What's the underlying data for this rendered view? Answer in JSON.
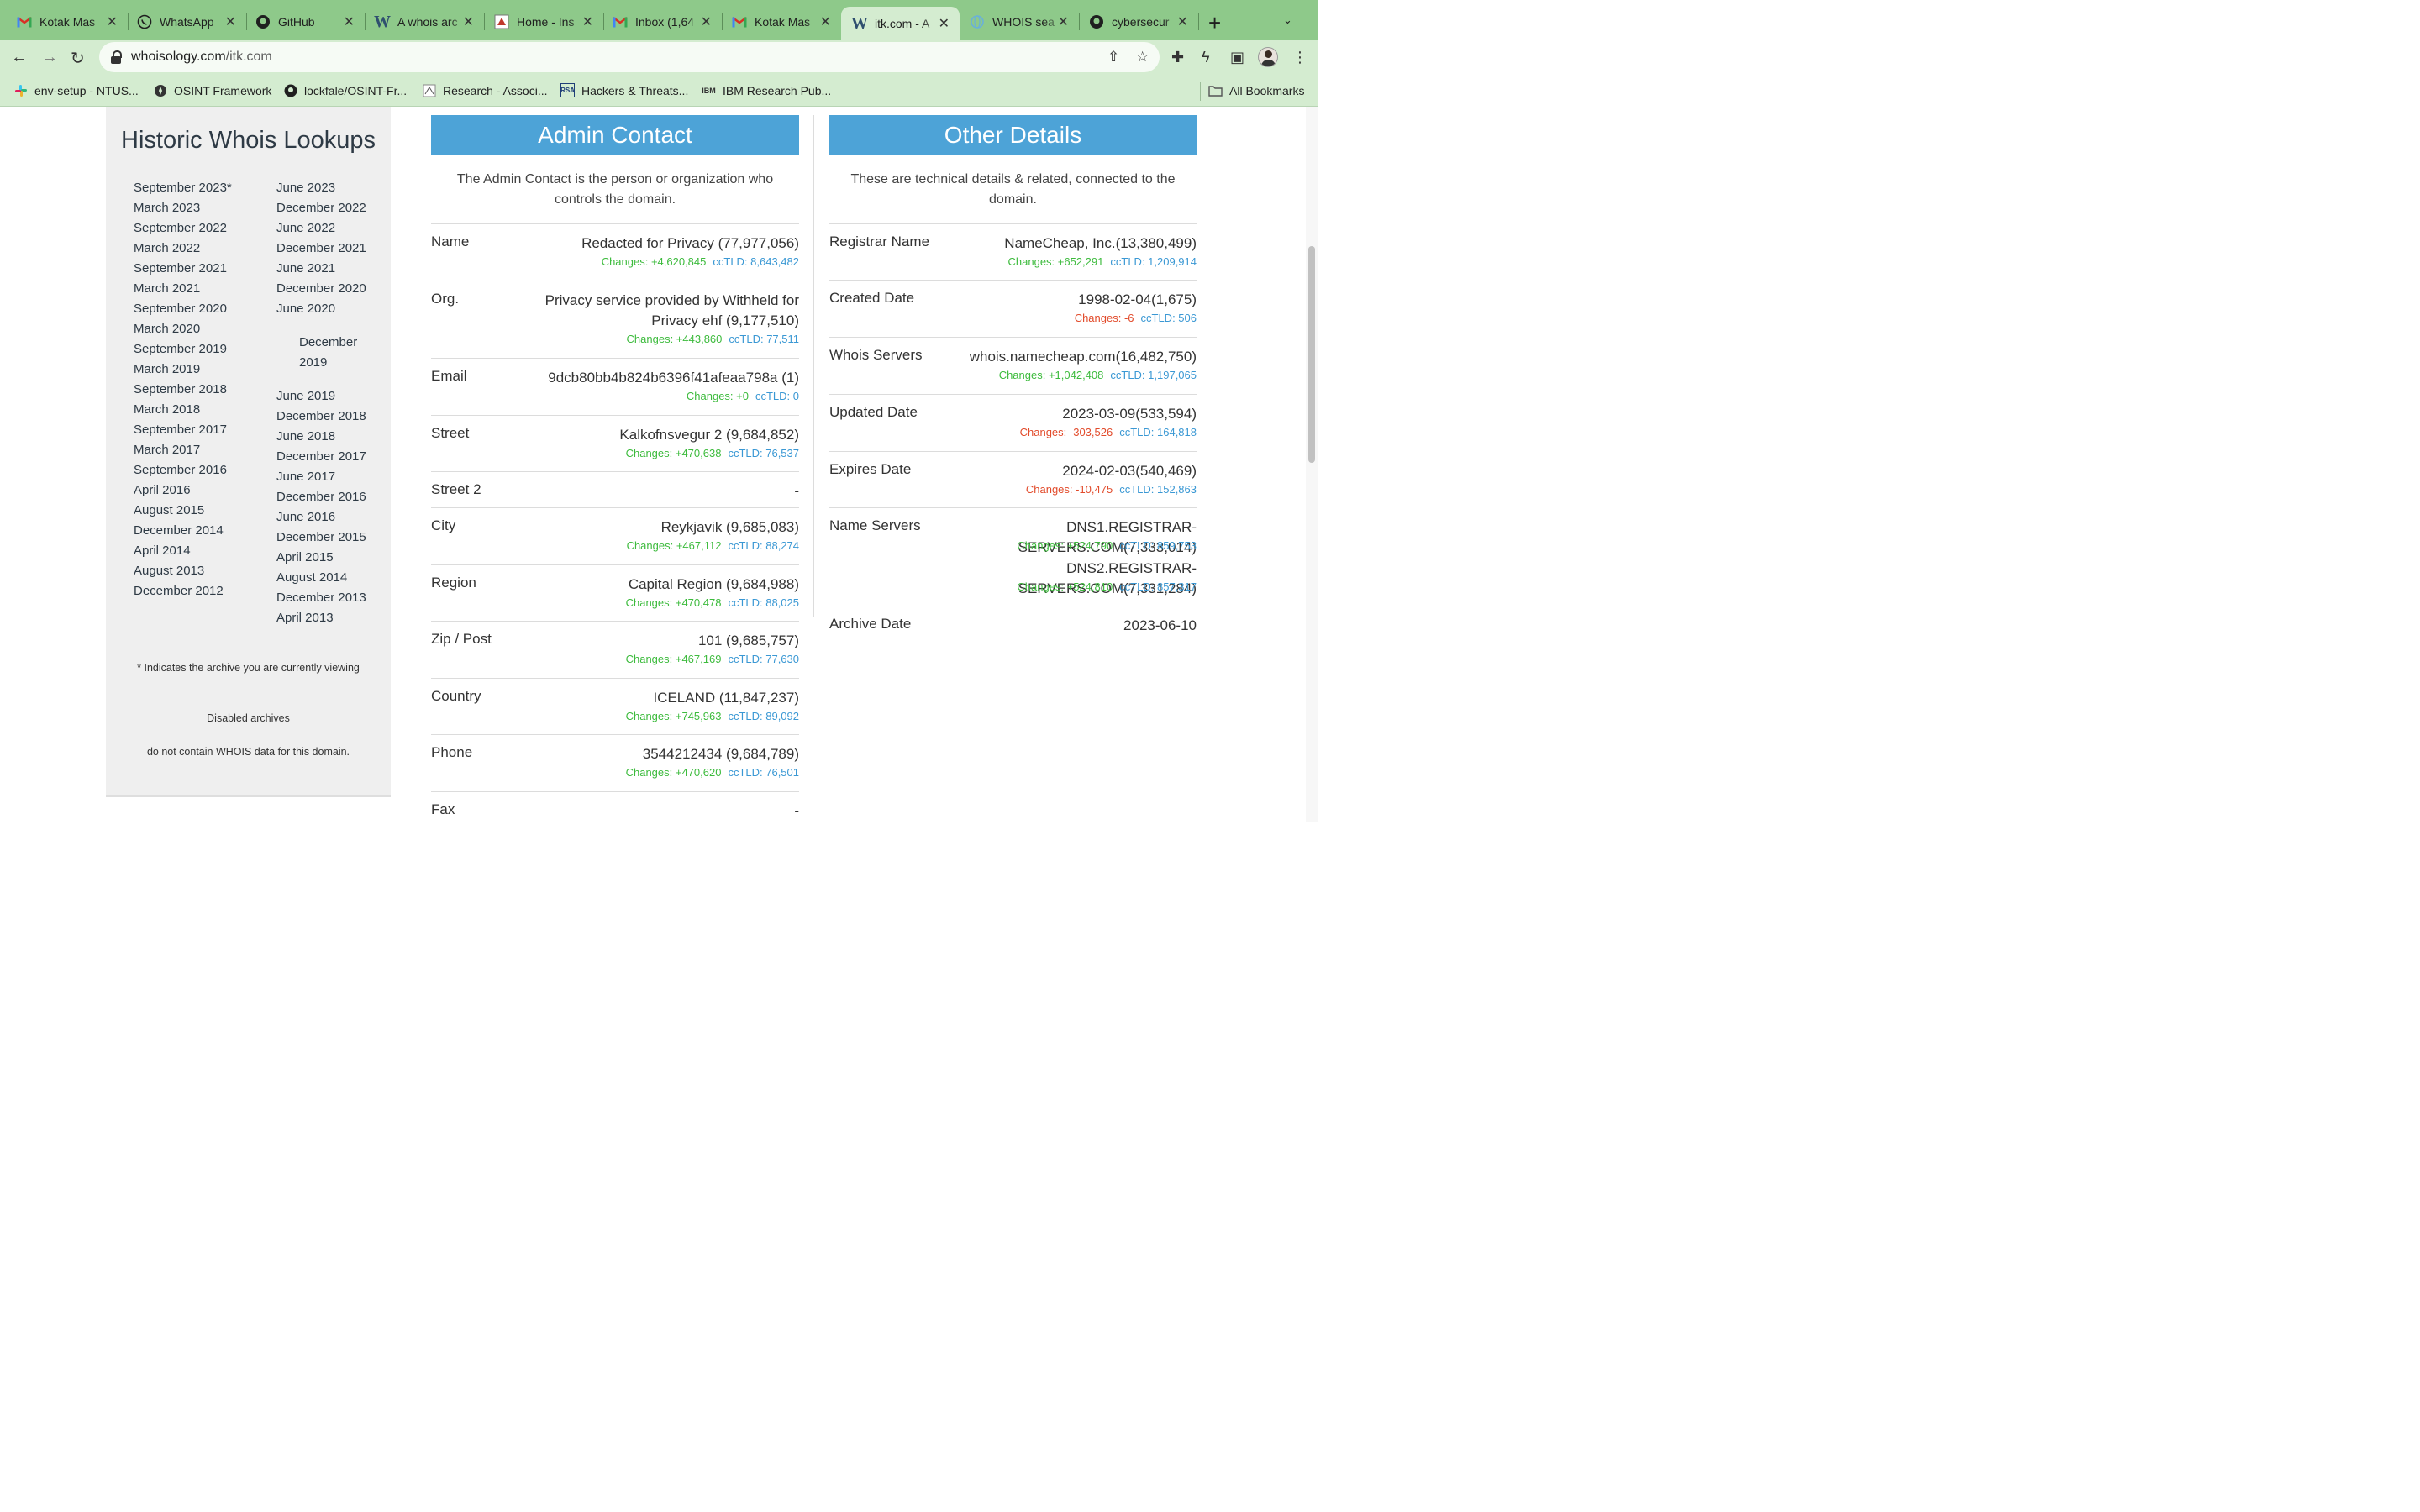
{
  "browser": {
    "tabs": [
      {
        "label": "Kotak Mas",
        "icon": "gmail-icon"
      },
      {
        "label": "WhatsApp",
        "icon": "whatsapp-icon"
      },
      {
        "label": "GitHub",
        "icon": "github-icon"
      },
      {
        "label": "A whois arc",
        "icon": "wordpress-icon"
      },
      {
        "label": "Home - Ins",
        "icon": "site-icon"
      },
      {
        "label": "Inbox (1,64",
        "icon": "gmail-icon"
      },
      {
        "label": "Kotak Mas",
        "icon": "gmail-icon"
      },
      {
        "label": "itk.com - A",
        "icon": "wordpress-icon"
      },
      {
        "label": "WHOIS sea",
        "icon": "globe-icon"
      },
      {
        "label": "cybersecur",
        "icon": "github-icon"
      }
    ],
    "url_domain": "whoisology.com",
    "url_path": "/itk.com",
    "bookmarks": [
      {
        "label": "env-setup - NTUS...",
        "icon": "slack-icon"
      },
      {
        "label": "OSINT Framework",
        "icon": "compass-icon"
      },
      {
        "label": "lockfale/OSINT-Fr...",
        "icon": "github-icon"
      },
      {
        "label": "Research - Associ...",
        "icon": "site-icon"
      },
      {
        "label": "Hackers & Threats...",
        "icon": "rsa-icon"
      },
      {
        "label": "IBM Research Pub...",
        "icon": "ibm-icon"
      }
    ],
    "all_bookmarks": "All Bookmarks"
  },
  "historic": {
    "title": "Historic Whois Lookups",
    "col1": [
      "September 2023*",
      "March 2023",
      "September 2022",
      "March 2022",
      "September 2021",
      "March 2021",
      "September 2020",
      "March 2020",
      "September 2019",
      "March 2019",
      "September 2018",
      "March 2018",
      "September 2017",
      "March 2017",
      "September 2016",
      "April 2016",
      "August 2015",
      "December 2014",
      "April 2014",
      "August 2013",
      "December 2012"
    ],
    "col2_top": [
      "June 2023",
      "December 2022",
      "June 2022",
      "December 2021",
      "June 2021",
      "December 2020",
      "June 2020"
    ],
    "col2_mid": [
      "December",
      "2019"
    ],
    "col2_bottom": [
      "June 2019",
      "December 2018",
      "June 2018",
      "December 2017",
      "June 2017",
      "December 2016",
      "June 2016",
      "December 2015",
      "April 2015",
      "August 2014",
      "December 2013",
      "April 2013"
    ],
    "note_current": "* Indicates the archive you are currently viewing",
    "note_disabled": "Disabled archives",
    "note_no_data": "do not contain WHOIS data for this domain."
  },
  "admin": {
    "title": "Admin Contact",
    "desc_line1": "The Admin Contact is the person or organization who",
    "desc_line2": "controls the domain.",
    "rows": [
      {
        "label": "Name",
        "value": "Redacted for Privacy (77,977,056)",
        "changes": "Changes: +4,620,845",
        "cctld": "ccTLD: 8,643,482",
        "change_color": "green"
      },
      {
        "label": "Org.",
        "value_line1": "Privacy service provided by Withheld for",
        "value_line2": "Privacy ehf (9,177,510)",
        "changes": "Changes: +443,860",
        "cctld": "ccTLD: 77,511",
        "change_color": "green"
      },
      {
        "label": "Email",
        "value": "9dcb80bb4b824b6396f41afeaa798a (1)",
        "changes": "Changes: +0",
        "cctld": "ccTLD: 0",
        "change_color": "green"
      },
      {
        "label": "Street",
        "value": "Kalkofnsvegur 2 (9,684,852)",
        "changes": "Changes: +470,638",
        "cctld": "ccTLD: 76,537",
        "change_color": "green"
      },
      {
        "label": "Street 2",
        "value": "-"
      },
      {
        "label": "City",
        "value": "Reykjavik (9,685,083)",
        "changes": "Changes: +467,112",
        "cctld": "ccTLD: 88,274",
        "change_color": "green"
      },
      {
        "label": "Region",
        "value": "Capital Region (9,684,988)",
        "changes": "Changes: +470,478",
        "cctld": "ccTLD: 88,025",
        "change_color": "green"
      },
      {
        "label": "Zip / Post",
        "value": "101 (9,685,757)",
        "changes": "Changes: +467,169",
        "cctld": "ccTLD: 77,630",
        "change_color": "green"
      },
      {
        "label": "Country",
        "value": "ICELAND (11,847,237)",
        "changes": "Changes: +745,963",
        "cctld": "ccTLD: 89,092",
        "change_color": "green"
      },
      {
        "label": "Phone",
        "value": "3544212434 (9,684,789)",
        "changes": "Changes: +470,620",
        "cctld": "ccTLD: 76,501",
        "change_color": "green"
      },
      {
        "label": "Fax",
        "value": "-"
      }
    ]
  },
  "other": {
    "title": "Other Details",
    "desc_line1": "These are technical details & related, connected to the",
    "desc_line2": "domain.",
    "rows": [
      {
        "label": "Registrar Name",
        "value": "NameCheap, Inc.(13,380,499)",
        "changes": "Changes: +652,291",
        "cctld": "ccTLD: 1,209,914",
        "change_color": "green"
      },
      {
        "label": "Created Date",
        "value": "1998-02-04(1,675)",
        "changes": "Changes: -6",
        "cctld": "ccTLD: 506",
        "change_color": "red"
      },
      {
        "label": "Whois Servers",
        "value": "whois.namecheap.com(16,482,750)",
        "changes": "Changes: +1,042,408",
        "cctld": "ccTLD: 1,197,065",
        "change_color": "green"
      },
      {
        "label": "Updated Date",
        "value": "2023-03-09(533,594)",
        "changes": "Changes: -303,526",
        "cctld": "ccTLD: 164,818",
        "change_color": "red"
      },
      {
        "label": "Expires Date",
        "value": "2024-02-03(540,469)",
        "changes": "Changes: -10,475",
        "cctld": "ccTLD: 152,863",
        "change_color": "red"
      },
      {
        "label": "Name Servers",
        "ns1": "DNS1.REGISTRAR-SERVERS.COM(7,333,014)",
        "ns1_changes": "Changes: +524,790",
        "ns1_cctld": "ccTLD: 859,753",
        "ns2": "DNS2.REGISTRAR-SERVERS.COM(7,331,284)",
        "ns2_changes": "Changes: +524,810",
        "ns2_cctld": "ccTLD: 857,317"
      },
      {
        "label": "Archive Date",
        "value": "2023-06-10"
      }
    ]
  }
}
